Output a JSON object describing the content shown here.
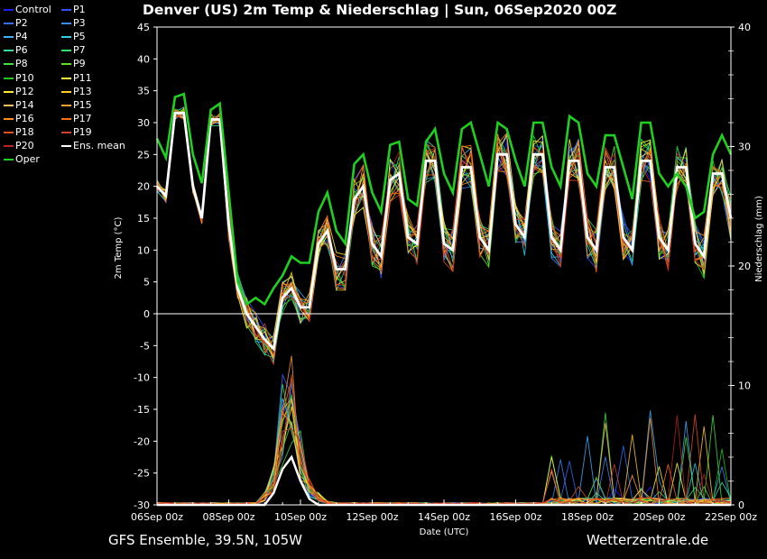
{
  "header": {
    "title": "Denver  (US)  2m Temp & Niederschlag | Sun, 06Sep2020 00Z"
  },
  "footer": {
    "left": "GFS Ensemble, 39.5N, 105W",
    "right": "Wetterzentrale.de"
  },
  "legend": [
    {
      "name": "Control",
      "color": "#2020ff"
    },
    {
      "name": "P1",
      "color": "#3050ff"
    },
    {
      "name": "P2",
      "color": "#3a6cff"
    },
    {
      "name": "P3",
      "color": "#3c8cff"
    },
    {
      "name": "P4",
      "color": "#40b0ff"
    },
    {
      "name": "P5",
      "color": "#30d0e8"
    },
    {
      "name": "P6",
      "color": "#30e0a0"
    },
    {
      "name": "P7",
      "color": "#30e070"
    },
    {
      "name": "P8",
      "color": "#40e040"
    },
    {
      "name": "P9",
      "color": "#60e020"
    },
    {
      "name": "P10",
      "color": "#20c820"
    },
    {
      "name": "P11",
      "color": "#ffff40"
    },
    {
      "name": "P12",
      "color": "#ffe830"
    },
    {
      "name": "P13",
      "color": "#ffd020"
    },
    {
      "name": "P14",
      "color": "#ffc060"
    },
    {
      "name": "P15",
      "color": "#ffa030"
    },
    {
      "name": "P16",
      "color": "#ff9020"
    },
    {
      "name": "P17",
      "color": "#ff7010"
    },
    {
      "name": "P18",
      "color": "#e05020"
    },
    {
      "name": "P19",
      "color": "#d04030"
    },
    {
      "name": "P20",
      "color": "#c02020"
    },
    {
      "name": "Ens. mean",
      "color": "#ffffff"
    },
    {
      "name": "Oper",
      "color": "#20d020"
    }
  ],
  "chart_data": {
    "type": "line",
    "title": "Denver  (US)  2m Temp & Niederschlag | Sun, 06Sep2020 00Z",
    "xlabel": "Date (UTC)",
    "ylabel": "2m Temp (°C)",
    "y2label": "Niederschlag (mm)",
    "x_ticks": [
      "06Sep 00z",
      "08Sep 00z",
      "10Sep 00z",
      "12Sep 00z",
      "14Sep 00z",
      "16Sep 00z",
      "18Sep 00z",
      "20Sep 00z",
      "22Sep 00z"
    ],
    "x_range_hours": [
      0,
      384
    ],
    "ylim": [
      -30,
      45
    ],
    "y_ticks": [
      -30,
      -25,
      -20,
      -15,
      -10,
      -5,
      0,
      5,
      10,
      15,
      20,
      25,
      30,
      35,
      40,
      45
    ],
    "y2lim": [
      0,
      40
    ],
    "y2_ticks": [
      0,
      10,
      20,
      30,
      40
    ],
    "zero_line": 0,
    "time_step_hours": 6,
    "series": [
      {
        "name": "Ens. mean",
        "color": "#ffffff",
        "values": [
          20,
          18.5,
          31.5,
          31.5,
          20,
          15,
          30.5,
          30.5,
          14,
          4,
          0,
          -2,
          -4,
          -5.5,
          2.5,
          4,
          1,
          1,
          11,
          13,
          7,
          7,
          18,
          20,
          11,
          9,
          21,
          22,
          12,
          11,
          24,
          24,
          11,
          10,
          23,
          23,
          12,
          10,
          25,
          25,
          14,
          12,
          25,
          25,
          12,
          10,
          24,
          24,
          12,
          10,
          23,
          23,
          12,
          10,
          24,
          24,
          12,
          10,
          23,
          23,
          11,
          9,
          22,
          22,
          15
        ]
      },
      {
        "name": "Oper",
        "color": "#20d020",
        "values": [
          27.5,
          24.5,
          34,
          34.5,
          25,
          20.5,
          32,
          33,
          19,
          5,
          1.5,
          2.5,
          1.5,
          4,
          6,
          9,
          8,
          8,
          16,
          19,
          13,
          11,
          23.5,
          25,
          19,
          16,
          26.5,
          27,
          18,
          17,
          27,
          29,
          22,
          19,
          29,
          30,
          25,
          20,
          30,
          29,
          24,
          20,
          30,
          30,
          23,
          20,
          31,
          30,
          22,
          20,
          28,
          28,
          23,
          18,
          30,
          30,
          22,
          20,
          22,
          20,
          15,
          16,
          25,
          28,
          25
        ]
      }
    ],
    "precip": {
      "unit": "mm",
      "peaks_mean": [
        {
          "day": "09Sep",
          "value": 4
        }
      ],
      "peaks_max": [
        {
          "day": "08Sep-09Sep",
          "value": 15
        },
        {
          "day": "19Sep",
          "value": 11
        },
        {
          "day": "20Sep",
          "value": 8.5
        },
        {
          "day": "22Sep",
          "value": 10
        }
      ]
    }
  }
}
